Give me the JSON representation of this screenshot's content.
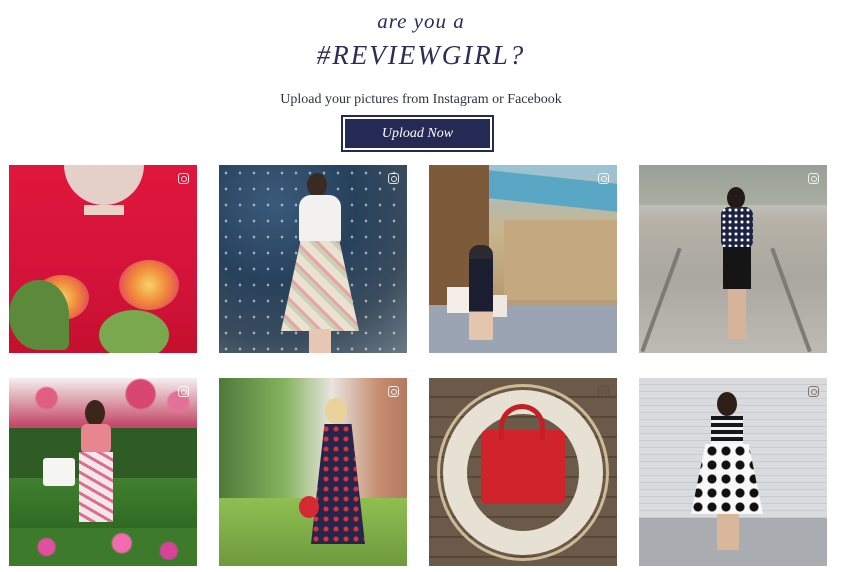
{
  "hero": {
    "kicker": "are you a",
    "hashtag": "#REVIEWGIRL?",
    "subtitle": "Upload your pictures from Instagram or Facebook",
    "upload_label": "Upload Now"
  },
  "colors": {
    "brand_navy": "#252a55",
    "heading": "#2a2d55",
    "background": "#ffffff"
  },
  "gallery": {
    "icon": "instagram-icon",
    "photo_count": 8
  }
}
